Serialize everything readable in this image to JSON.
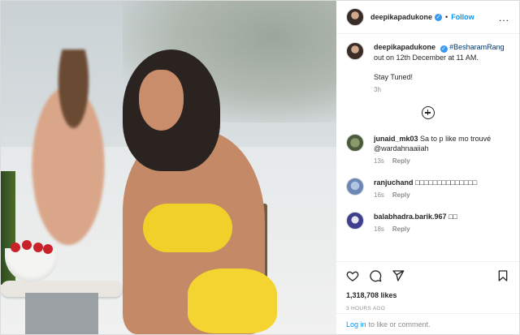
{
  "header": {
    "username": "deepikapadukone",
    "follow_label": "Follow",
    "more_label": "..."
  },
  "caption": {
    "username": "deepikapadukone",
    "text_line1": "#BesharamRang",
    "text_line2": "out on 12th December at 11 AM.",
    "text_line3": "Stay Tuned!",
    "age": "3h"
  },
  "comments": [
    {
      "username": "junaid_mk03",
      "text": "Sa to p like mo trouvé @wardahnaaiiah",
      "age": "13s",
      "reply": "Reply"
    },
    {
      "username": "ranjuchand",
      "text": "□□□□□□□□□□□□□□",
      "age": "16s",
      "reply": "Reply"
    },
    {
      "username": "balabhadra.barik.967",
      "text": "□□",
      "age": "18s",
      "reply": "Reply"
    }
  ],
  "actions": {
    "likes": "1,318,708 likes",
    "time": "3 hours ago"
  },
  "footer": {
    "login": "Log in",
    "rest": "to like or comment."
  },
  "icons": [
    "more-icon",
    "verified-icon",
    "plus-circle-icon",
    "heart-icon",
    "comment-icon",
    "share-icon",
    "bookmark-icon"
  ],
  "colors": {
    "link": "#0095f6",
    "verified": "#3897f0",
    "muted": "#8e8e8e"
  }
}
